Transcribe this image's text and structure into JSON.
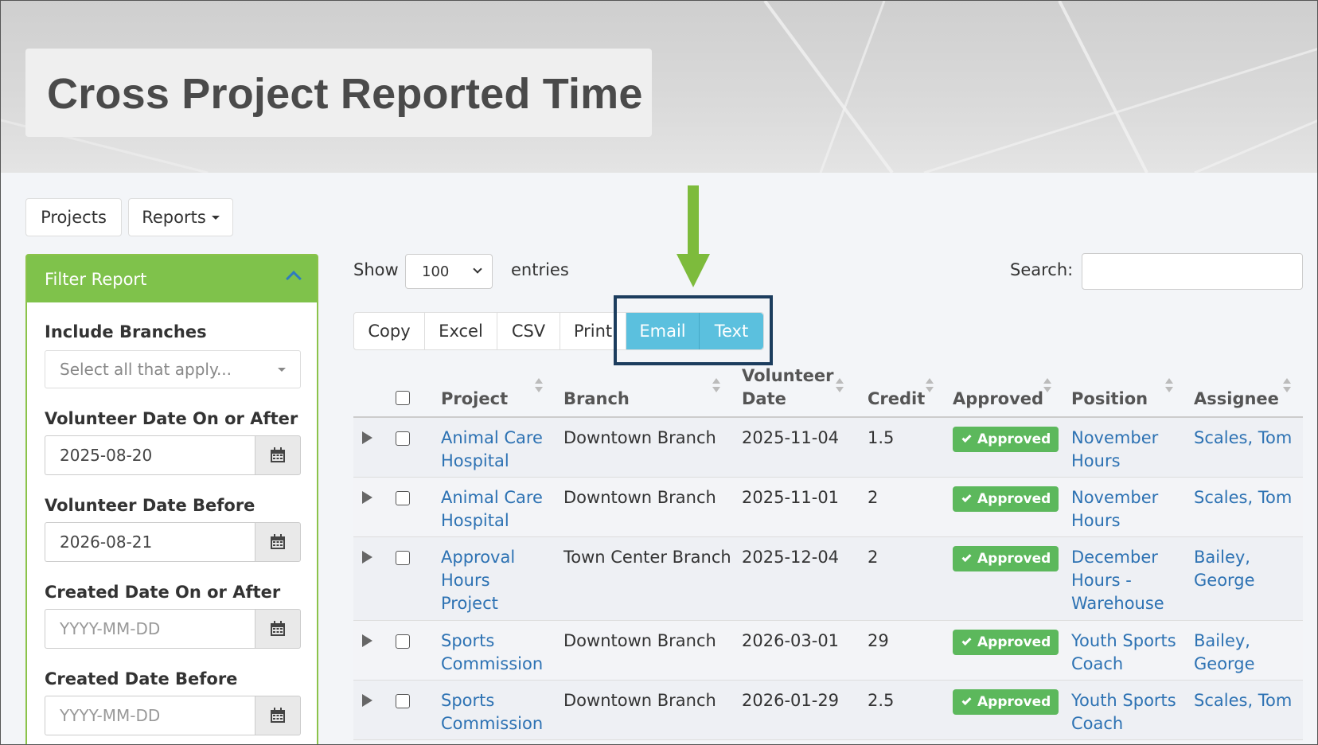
{
  "page": {
    "title": "Cross Project Reported Time"
  },
  "nav": {
    "projects_label": "Projects",
    "reports_label": "Reports"
  },
  "filter": {
    "header": "Filter Report",
    "include_branches_label": "Include Branches",
    "branches_placeholder": "Select all that apply...",
    "vol_after_label": "Volunteer Date On or After",
    "vol_after_value": "2025-08-20",
    "vol_before_label": "Volunteer Date Before",
    "vol_before_value": "2026-08-21",
    "created_after_label": "Created Date On or After",
    "created_after_placeholder": "YYYY-MM-DD",
    "created_before_label": "Created Date Before",
    "created_before_placeholder": "YYYY-MM-DD"
  },
  "controls": {
    "show_label": "Show",
    "entries_value": "100",
    "entries_label": "entries",
    "search_label": "Search:"
  },
  "buttons": {
    "copy": "Copy",
    "excel": "Excel",
    "csv": "CSV",
    "print": "Print",
    "email": "Email",
    "text": "Text"
  },
  "table": {
    "headers": {
      "project": "Project",
      "branch": "Branch",
      "volunteer_date_1": "Volunteer",
      "volunteer_date_2": "Date",
      "credit": "Credit",
      "approved": "Approved",
      "position": "Position",
      "assignee": "Assignee"
    },
    "rows": [
      {
        "project": [
          "Animal Care",
          "Hospital"
        ],
        "branch": "Downtown Branch",
        "date": "2025-11-04",
        "credit": "1.5",
        "status": "Approved",
        "position": [
          "November",
          "Hours"
        ],
        "assignee": [
          "Scales, Tom"
        ]
      },
      {
        "project": [
          "Animal Care",
          "Hospital"
        ],
        "branch": "Downtown Branch",
        "date": "2025-11-01",
        "credit": "2",
        "status": "Approved",
        "position": [
          "November",
          "Hours"
        ],
        "assignee": [
          "Scales, Tom"
        ]
      },
      {
        "project": [
          "Approval",
          "Hours",
          "Project"
        ],
        "branch": "Town Center Branch",
        "date": "2025-12-04",
        "credit": "2",
        "status": "Approved",
        "position": [
          "December",
          "Hours -",
          "Warehouse"
        ],
        "assignee": [
          "Bailey,",
          "George"
        ]
      },
      {
        "project": [
          "Sports",
          "Commission"
        ],
        "branch": "Downtown Branch",
        "date": "2026-03-01",
        "credit": "29",
        "status": "Approved",
        "position": [
          "Youth Sports",
          "Coach"
        ],
        "assignee": [
          "Bailey,",
          "George"
        ]
      },
      {
        "project": [
          "Sports",
          "Commission"
        ],
        "branch": "Downtown Branch",
        "date": "2026-01-29",
        "credit": "2.5",
        "status": "Approved",
        "position": [
          "Youth Sports",
          "Coach"
        ],
        "assignee": [
          "Scales, Tom"
        ]
      }
    ]
  }
}
